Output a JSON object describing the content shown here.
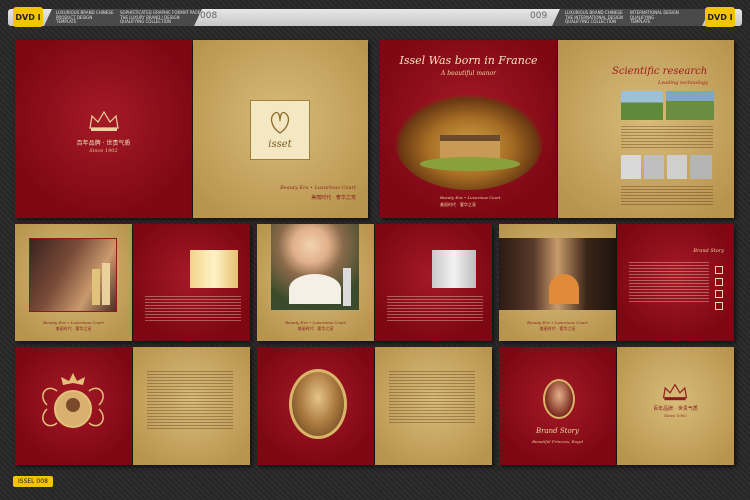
{
  "header": {
    "left_badge": "DVD I",
    "right_badge": "DVD I",
    "page_left": "008",
    "page_right": "009",
    "small_text_1": "LUXURIOUS BRAND CHINESE\nPRODUCT DESIGN\nTEMPLATE",
    "small_text_2": "SOPHISTICATED GRAPHIC FORMAT PACK\nTHE LUXURY BRAND / DESIGN\nQUALIFYING COLLECTION",
    "small_text_3": "LUXURIOUS BRAND CHINESE\nTHE INTERNATIONAL DESIGN\nQUALIFYING COLLECTION",
    "small_text_4": "INTERNATIONAL DESIGN\nQUALIFYING\nTEMPLATE"
  },
  "footer": {
    "file_id": "ISSEL 008"
  },
  "row1": {
    "cover_left_chinese": "百年品牌 · 世贵气质",
    "cover_left_sub": "Since 1902",
    "logo_word": "isset",
    "tagline_en": "Beauty Era • Luxurious Court",
    "tagline_cn": "美丽时代 · 奢华之宠",
    "france_title": "Issel Was born in France",
    "france_sub": "A beautiful manor",
    "france_caption_en": "Beauty Era • Luxurious Court",
    "france_caption_cn": "美丽时代 · 奢华之宠",
    "science_title": "Scientific research",
    "science_sub": "Leading technology"
  },
  "row2": {
    "caption_en": "Beauty Era • Luxurious Court",
    "caption_cn": "美丽时代 · 奢华之宠",
    "title_right": "Brand Story"
  },
  "row3": {
    "brand_story": "Brand Story",
    "brand_story_sub": "Beautiful Princess, Royal",
    "cover_right_chinese": "百年品牌 · 世贵气质",
    "cover_right_sub": "Since 1902"
  },
  "colors": {
    "red": "#8f0d1c",
    "gold": "#c9a964",
    "accent": "#f2c500"
  }
}
